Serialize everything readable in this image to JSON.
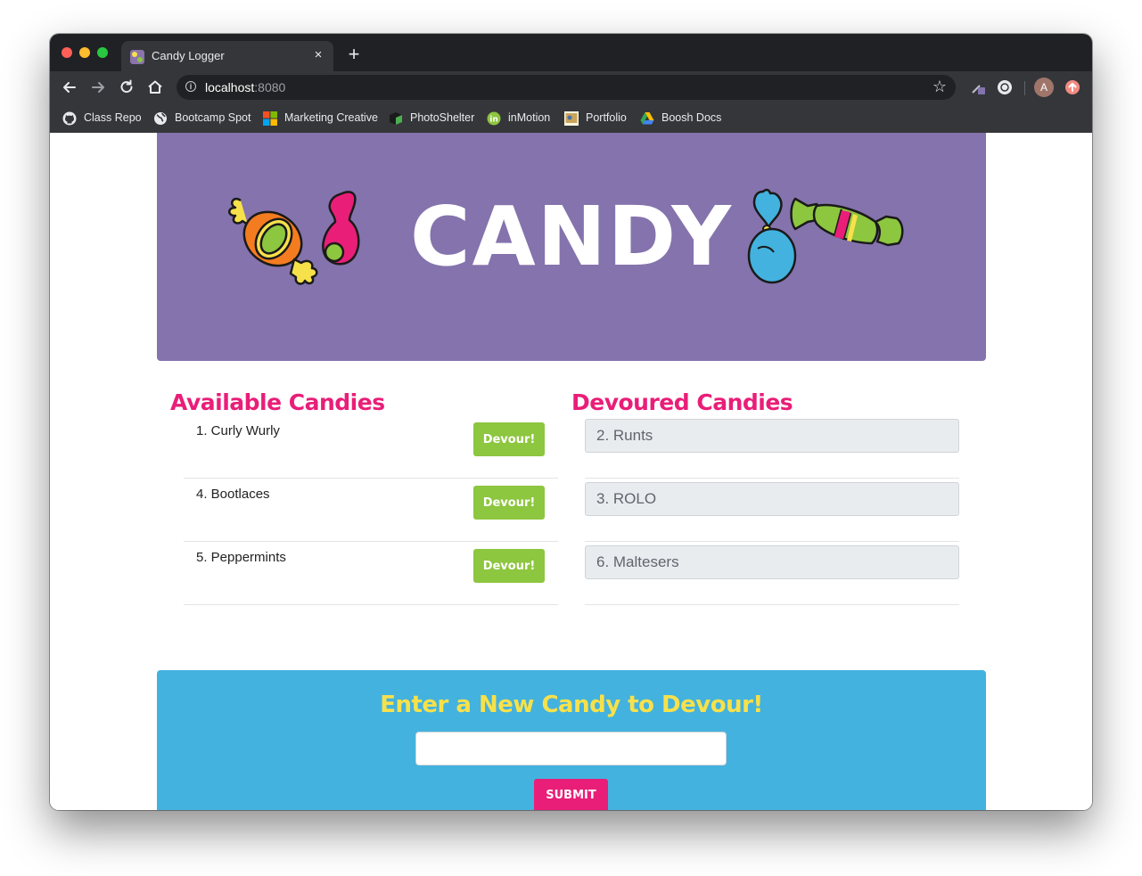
{
  "browser": {
    "tab_title": "Candy Logger",
    "tab_close": "×",
    "new_tab": "+",
    "url_host": "localhost",
    "url_port": ":8080",
    "avatar_initial": "A",
    "bookmarks": [
      {
        "label": "Class Repo",
        "icon": "github-icon"
      },
      {
        "label": "Bootcamp Spot",
        "icon": "globe-icon"
      },
      {
        "label": "Marketing Creative",
        "icon": "microsoft-icon"
      },
      {
        "label": "PhotoShelter",
        "icon": "photoshelter-icon"
      },
      {
        "label": "inMotion",
        "icon": "invision-icon"
      },
      {
        "label": "Portfolio",
        "icon": "portfolio-icon"
      },
      {
        "label": "Boosh Docs",
        "icon": "google-drive-icon"
      }
    ]
  },
  "hero": {
    "title": "CANDY"
  },
  "available": {
    "heading": "Available Candies",
    "items": [
      {
        "label": "1. Curly Wurly",
        "button": "Devour!"
      },
      {
        "label": "4. Bootlaces",
        "button": "Devour!"
      },
      {
        "label": "5. Peppermints",
        "button": "Devour!"
      }
    ]
  },
  "devoured": {
    "heading": "Devoured Candies",
    "items": [
      "2. Runts",
      "3. ROLO",
      "6. Maltesers"
    ]
  },
  "form": {
    "heading": "Enter a New Candy to Devour!",
    "input_value": "",
    "submit_label": "SUBMIT"
  },
  "colors": {
    "hero_bg": "#8473ac",
    "heading_pink": "#e91e78",
    "devour_green": "#8dc63f",
    "form_blue": "#43b2df",
    "form_heading_yellow": "#f7e14b"
  }
}
